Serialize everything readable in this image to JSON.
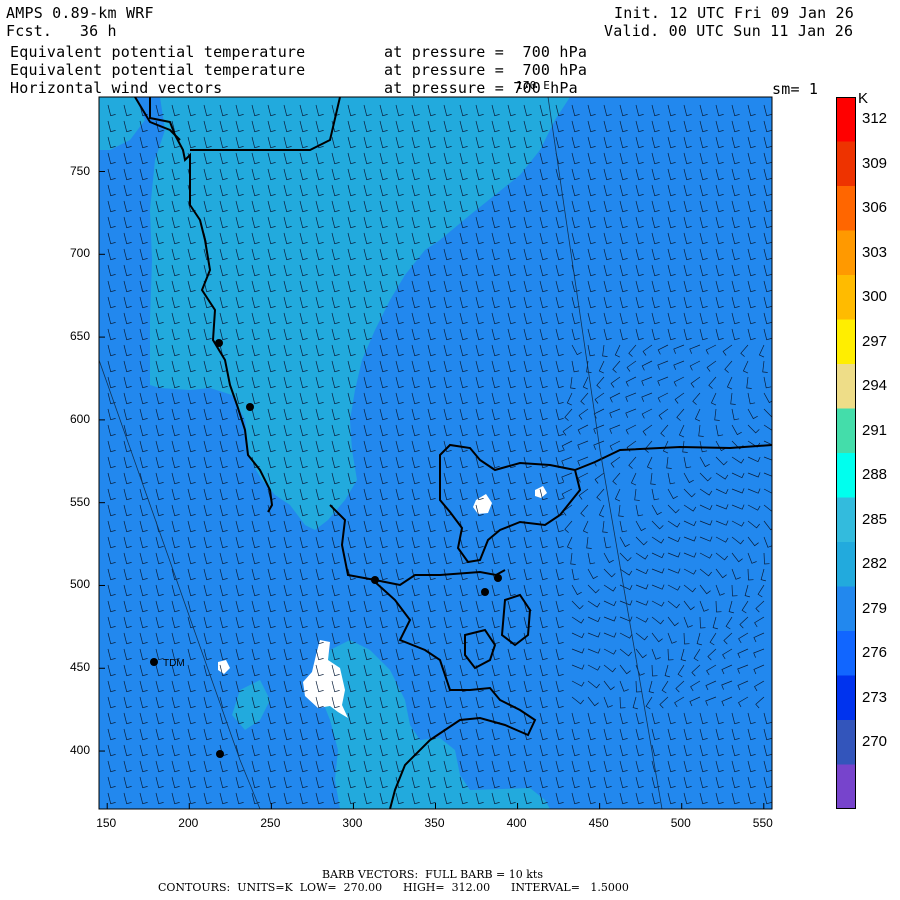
{
  "header": {
    "model": "AMPS 0.89-km WRF",
    "forecast": "Fcst.   36 h",
    "init": "Init. 12 UTC Fri 09 Jan 26",
    "valid": "Valid. 00 UTC Sun 11 Jan 26",
    "field1_name": "Equivalent potential temperature",
    "field1_level": "at pressure =  700 hPa",
    "field2_name": "Equivalent potential temperature",
    "field2_level": "at pressure =  700 hPa",
    "field3_name": "Horizontal wind vectors",
    "field3_level": "at pressure = 700 hPa",
    "longitude_marker": "170 E",
    "smoothing": "sm= 1"
  },
  "map": {
    "x_ticks": [
      "150",
      "200",
      "250",
      "300",
      "350",
      "400",
      "450",
      "500",
      "550"
    ],
    "y_ticks": [
      "750",
      "700",
      "650",
      "600",
      "550",
      "500",
      "450",
      "400"
    ],
    "x_range": [
      145,
      555
    ],
    "y_range": [
      365,
      795
    ],
    "station_label": "TDM",
    "background_color": "#2288ee",
    "warm_color": "#22aadd",
    "land_color": "#ffffff"
  },
  "colorbar": {
    "unit": "K",
    "labels": [
      "312",
      "309",
      "306",
      "303",
      "300",
      "297",
      "294",
      "291",
      "288",
      "285",
      "282",
      "279",
      "276",
      "273",
      "270"
    ],
    "colors": [
      "#ff0000",
      "#ee3300",
      "#ff6600",
      "#ff9900",
      "#ffbb00",
      "#ffee00",
      "#eedd88",
      "#44ddaa",
      "#00ffee",
      "#33bbdd",
      "#22aadd",
      "#2288ee",
      "#1166ff",
      "#0033ee",
      "#3355bb",
      "#7744cc"
    ]
  },
  "footer": {
    "barb_line": "BARB VECTORS:  FULL BARB = 10 kts",
    "contour_line": "CONTOURS:  UNITS=K  LOW=  270.00      HIGH=  312.00      INTERVAL=   1.5000"
  }
}
